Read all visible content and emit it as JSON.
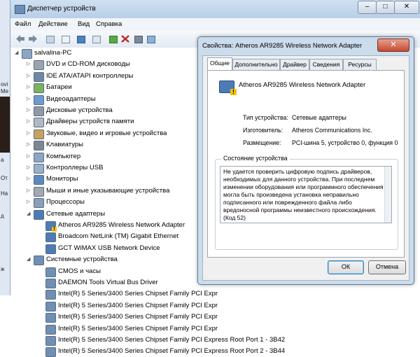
{
  "background_app": {
    "fragments": [
      "ovi",
      "Me",
      "a",
      "От",
      "На",
      "д",
      "ж"
    ]
  },
  "main_window": {
    "title": "Диспетчер устройств",
    "controls": {
      "minimize": "–",
      "maximize": "□",
      "close": "✕"
    },
    "menu": [
      "Файл",
      "Действие",
      "Вид",
      "Справка"
    ],
    "toolbar_icons": [
      "back-arrow-icon",
      "forward-arrow-icon",
      "console-tree-icon",
      "properties-icon",
      "help-icon",
      "view-icon",
      "update-driver-icon",
      "disable-device-icon",
      "uninstall-device-icon",
      "scan-hardware-icon"
    ]
  },
  "device_tree": {
    "root": "salvalina-PC",
    "categories": [
      {
        "label": "DVD и CD-ROM дисководы",
        "icon": "dvd-drive-icon"
      },
      {
        "label": "IDE ATA/ATAPI контроллеры",
        "icon": "ide-controller-icon"
      },
      {
        "label": "Батареи",
        "icon": "battery-icon"
      },
      {
        "label": "Видеоадаптеры",
        "icon": "display-adapter-icon"
      },
      {
        "label": "Дисковые устройства",
        "icon": "disk-drive-icon"
      },
      {
        "label": "Драйверы устройств памяти",
        "icon": "memory-device-icon"
      },
      {
        "label": "Звуковые, видео и игровые устройства",
        "icon": "sound-device-icon"
      },
      {
        "label": "Клавиатуры",
        "icon": "keyboard-icon"
      },
      {
        "label": "Компьютер",
        "icon": "computer-icon"
      },
      {
        "label": "Контроллеры USB",
        "icon": "usb-controller-icon"
      },
      {
        "label": "Мониторы",
        "icon": "monitor-icon"
      },
      {
        "label": "Мыши и иные указывающие устройства",
        "icon": "mouse-icon"
      },
      {
        "label": "Процессоры",
        "icon": "processor-icon"
      }
    ],
    "network": {
      "label": "Сетевые адаптеры",
      "children": [
        {
          "label": "Atheros AR9285 Wireless Network Adapter",
          "warning": true
        },
        {
          "label": "Broadcom NetLink (TM) Gigabit Ethernet",
          "warning": false
        },
        {
          "label": "GCT WiMAX USB Network Device",
          "warning": false
        }
      ]
    },
    "system": {
      "label": "Системные устройства",
      "children": [
        "CMOS и часы",
        "DAEMON Tools Virtual Bus Driver",
        "Intel(R) 5 Series/3400 Series Chipset Family PCI Expr",
        "Intel(R) 5 Series/3400 Series Chipset Family PCI Expr",
        "Intel(R) 5 Series/3400 Series Chipset Family PCI Expr",
        "Intel(R) 5 Series/3400 Series Chipset Family PCI Expr",
        "Intel(R) 5 Series/3400 Series Chipset Family PCI Express Root Port 1 - 3B42",
        "Intel(R) 5 Series/3400 Series Chipset Family PCI Express Root Port 2 - 3B44"
      ]
    }
  },
  "dialog": {
    "title": "Свойства: Atheros AR9285 Wireless Network Adapter",
    "close": "✕",
    "tabs": [
      "Общие",
      "Дополнительно",
      "Драйвер",
      "Сведения",
      "Ресурсы"
    ],
    "device_name": "Atheros AR9285 Wireless Network Adapter",
    "props": [
      {
        "label": "Тип устройства:",
        "value": "Сетевые адаптеры"
      },
      {
        "label": "Изготовитель:",
        "value": "Atheros Communications Inc."
      },
      {
        "label": "Размещение:",
        "value": "PCI-шина 5, устройство 0, функция 0"
      }
    ],
    "status_label": "Состояние устройства",
    "status_text": "Не удается проверить цифровую подпись драйверов, необходимых для данного устройства. При последнем изменении оборудования или программного обеспечения могла быть произведена установка неправильно подписанного или поврежденного файла либо вредоносной программы неизвестного происхождения. (Код 52)",
    "ok": "ОК",
    "cancel": "Отмена"
  }
}
